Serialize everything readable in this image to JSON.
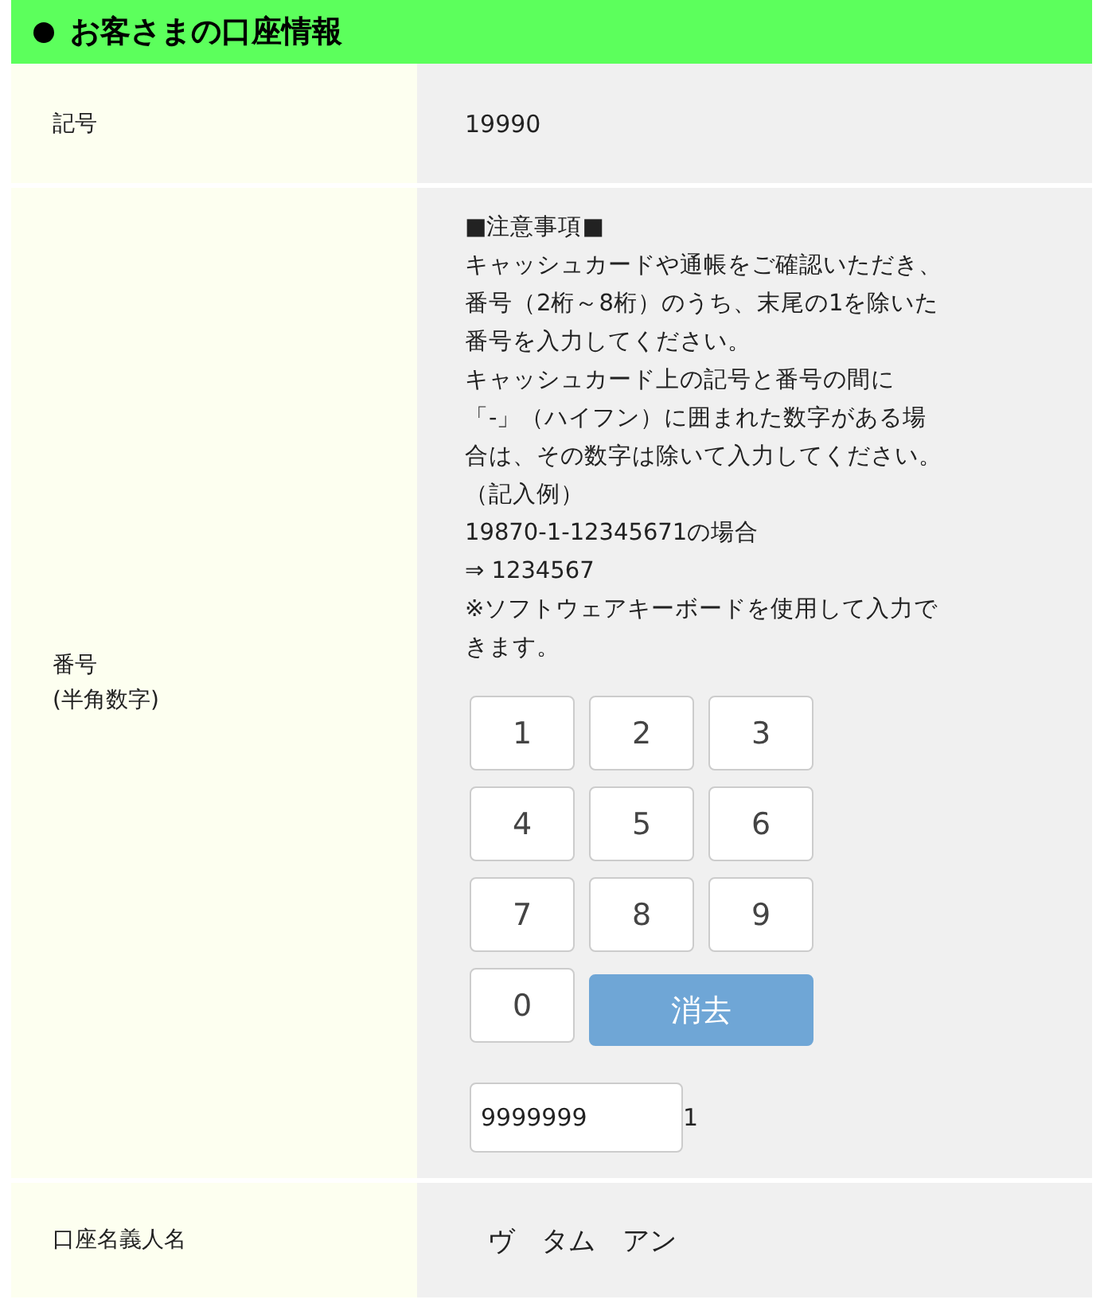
{
  "section": {
    "title": "お客さまの口座情報"
  },
  "rows": [
    {
      "kind": "text",
      "label": [
        "記号"
      ],
      "value": "19990"
    },
    {
      "kind": "keypad",
      "label": [
        "番号",
        "(半角数字)"
      ],
      "notes": [
        "■注意事項■",
        "キャッシュカードや通帳をご確認いただき、",
        "番号（2桁～8桁）のうち、末尾の1を除いた",
        "番号を入力してください。",
        "キャッシュカード上の記号と番号の間に",
        "「-」（ハイフン）に囲まれた数字がある場",
        "合は、その数字は除いて入力してください。",
        "（記入例）",
        "19870-1-12345671の場合",
        "⇒ 1234567",
        "※ソフトウェアキーボードを使用して入力で",
        "きます。"
      ],
      "keys": [
        {
          "kind": "digit",
          "label": "1"
        },
        {
          "kind": "digit",
          "label": "2"
        },
        {
          "kind": "digit",
          "label": "3"
        },
        {
          "kind": "digit",
          "label": "4"
        },
        {
          "kind": "digit",
          "label": "5"
        },
        {
          "kind": "digit",
          "label": "6"
        },
        {
          "kind": "digit",
          "label": "7"
        },
        {
          "kind": "digit",
          "label": "8"
        },
        {
          "kind": "digit",
          "label": "9"
        },
        {
          "kind": "digit",
          "label": "0"
        },
        {
          "kind": "clear",
          "label": "消去"
        }
      ],
      "input": {
        "value": "9999999",
        "suffix": "1"
      }
    },
    {
      "kind": "name",
      "label": [
        "口座名義人名"
      ],
      "value": "ヴ　タム　アン"
    }
  ]
}
